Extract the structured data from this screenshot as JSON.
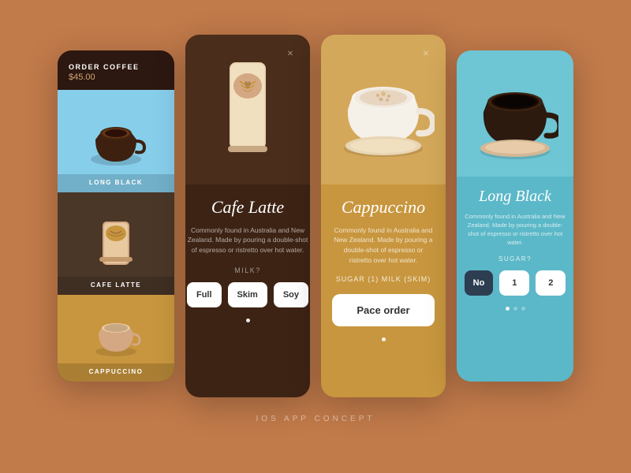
{
  "page": {
    "background": "#C17A4A",
    "footer_label": "IOS APP CONCEPT"
  },
  "card1": {
    "title": "ORDER COFFEE",
    "price": "$45.00",
    "items": [
      {
        "label": "LONG BLACK",
        "bg": "#87CEEB"
      },
      {
        "label": "CAFE LATTE",
        "bg": "#4A3728"
      },
      {
        "label": "CAPPUCCINO",
        "bg": "#C8963E"
      }
    ]
  },
  "card2": {
    "title": "Cafe Latte",
    "description": "Commonly found in Australia and New Zealand. Made by pouring a double-shot of espresso or ristretto over hot water.",
    "option_label": "MILK?",
    "options": [
      "Full",
      "Skim",
      "Soy"
    ],
    "close": "×"
  },
  "card3": {
    "title": "Cappuccino",
    "description": "Commonly found in Australia and New Zealand. Made by pouring a double-shot of espresso or ristretto over hot water.",
    "options_selected": "SUGAR (1)  MILK (SKIM)",
    "place_order_btn": "Pace order",
    "close": "×"
  },
  "card4": {
    "title": "Long Black",
    "description": "Commonly found in Australia and New Zealand. Made by pouring a double-shot of espresso or ristretto over hot water.",
    "option_label": "SUGAR?",
    "options": [
      "No",
      "1",
      "2"
    ]
  }
}
